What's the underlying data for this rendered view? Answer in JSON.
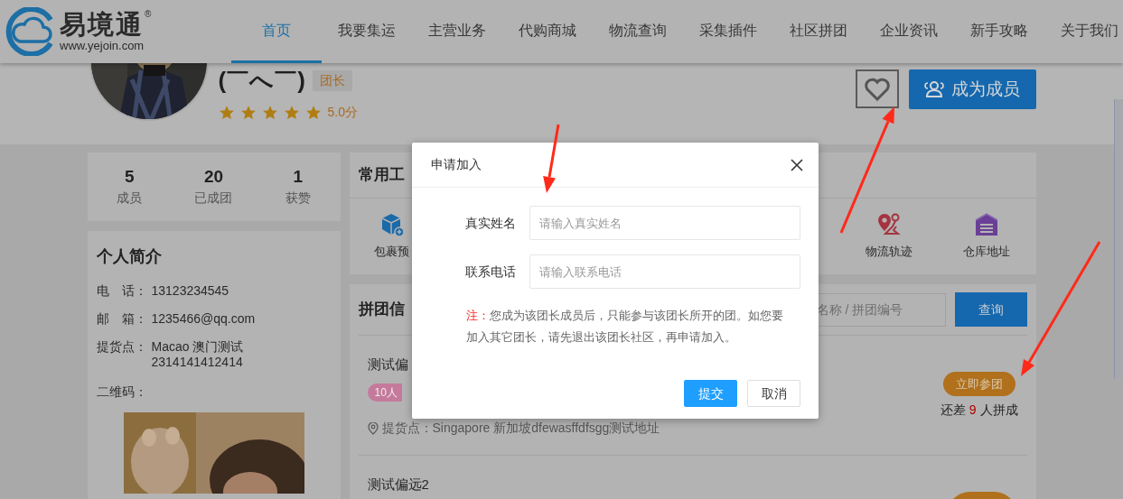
{
  "nav": {
    "logo_text": "易境通",
    "logo_mark": "®",
    "logo_url": "www.yejoin.com",
    "items": [
      {
        "label": "首页",
        "selected": true
      },
      {
        "label": "我要集运",
        "selected": false
      },
      {
        "label": "主营业务",
        "selected": false
      },
      {
        "label": "代购商城",
        "selected": false
      },
      {
        "label": "物流查询",
        "selected": false
      },
      {
        "label": "采集插件",
        "selected": false
      },
      {
        "label": "社区拼团",
        "selected": false
      },
      {
        "label": "企业资讯",
        "selected": false
      },
      {
        "label": "新手攻略",
        "selected": false
      },
      {
        "label": "关于我们",
        "selected": false
      }
    ]
  },
  "profile": {
    "name": "(￣へ￣)",
    "badge": "团长",
    "stars": 5,
    "score": "5.0分",
    "join_button": "成为成员"
  },
  "stats": [
    {
      "value": "5",
      "label": "成员"
    },
    {
      "value": "20",
      "label": "已成团"
    },
    {
      "value": "1",
      "label": "获赞"
    }
  ],
  "bio": {
    "title": "个人简介",
    "fields": [
      {
        "label": "电　话：",
        "value": "13123234545"
      },
      {
        "label": "邮　箱：",
        "value": "1235466@qq.com"
      },
      {
        "label": "提货点：",
        "value": "Macao 澳门测试 2314141412414"
      }
    ],
    "qr_label": "二维码："
  },
  "tools": {
    "title": "常用工",
    "items": [
      {
        "label": "包裹预",
        "kind": "package"
      },
      {
        "label": "物流轨迹",
        "kind": "route"
      },
      {
        "label": "仓库地址",
        "kind": "warehouse"
      }
    ]
  },
  "groups": {
    "title": "拼团信",
    "search": {
      "placeholder": "名称 / 拼团编号"
    },
    "search_button": "查询",
    "items": [
      {
        "title": "测试偏",
        "tag": "10人",
        "pickup": "提货点：Singapore 新加坡dfewasffdfsgg测试地址",
        "join_button": "立即参团",
        "remaining_before": "还差",
        "remaining_count": "9",
        "remaining_after": "人拼成"
      },
      {
        "title": "测试偏远2"
      }
    ]
  },
  "dialog": {
    "title": "申请加入",
    "fields": [
      {
        "label": "真实姓名",
        "placeholder": "请输入真实姓名"
      },
      {
        "label": "联系电话",
        "placeholder": "请输入联系电话"
      }
    ],
    "note_label": "注：",
    "note": "您成为该团长成员后，只能参与该团长所开的团。如您要加入其它团长，请先退出该团长社区，再申请加入。",
    "buttons": [
      {
        "label": "提交",
        "kind": "primary"
      },
      {
        "label": "取消",
        "kind": "default"
      }
    ]
  }
}
